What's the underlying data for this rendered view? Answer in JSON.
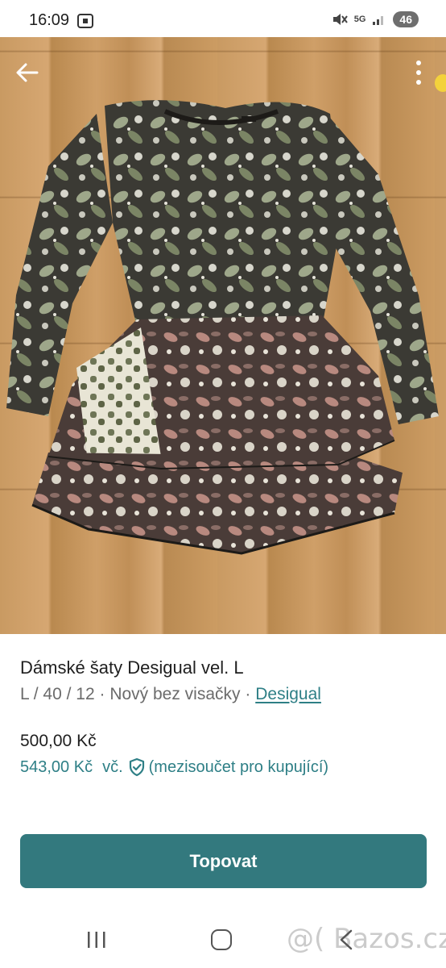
{
  "status_bar": {
    "time": "16:09",
    "network": "5G",
    "battery": "46",
    "icons": [
      "screenshot-icon",
      "mute-icon",
      "network-5g-icon",
      "signal-icon",
      "battery-icon"
    ]
  },
  "toolbar": {
    "back_icon": "arrow-left-icon",
    "more_icon": "more-vertical-icon"
  },
  "gallery": {
    "image_count": 2,
    "active_index": 0
  },
  "listing": {
    "title": "Dámské šaty Desigual vel. L",
    "size": "L / 40 / 12",
    "separator": "·",
    "condition": "Nový bez visačky",
    "brand": "Desigual",
    "price": "500,00 Kč",
    "buyer_price": "543,00 Kč",
    "buyer_price_prefix": "vč.",
    "buyer_note": "(mezisoučet pro kupující)",
    "shield_icon": "shield-check-icon"
  },
  "actions": {
    "topovat_label": "Topovat"
  },
  "navigation": {
    "recents_icon": "recents-icon",
    "home_icon": "home-icon",
    "back_icon": "nav-back-icon"
  },
  "watermark": {
    "text": "@( Bazos.cz"
  },
  "colors": {
    "accent": "#2e7f86",
    "button": "#33797e",
    "text": "#1f1f1f",
    "muted": "#6b6b6b"
  }
}
